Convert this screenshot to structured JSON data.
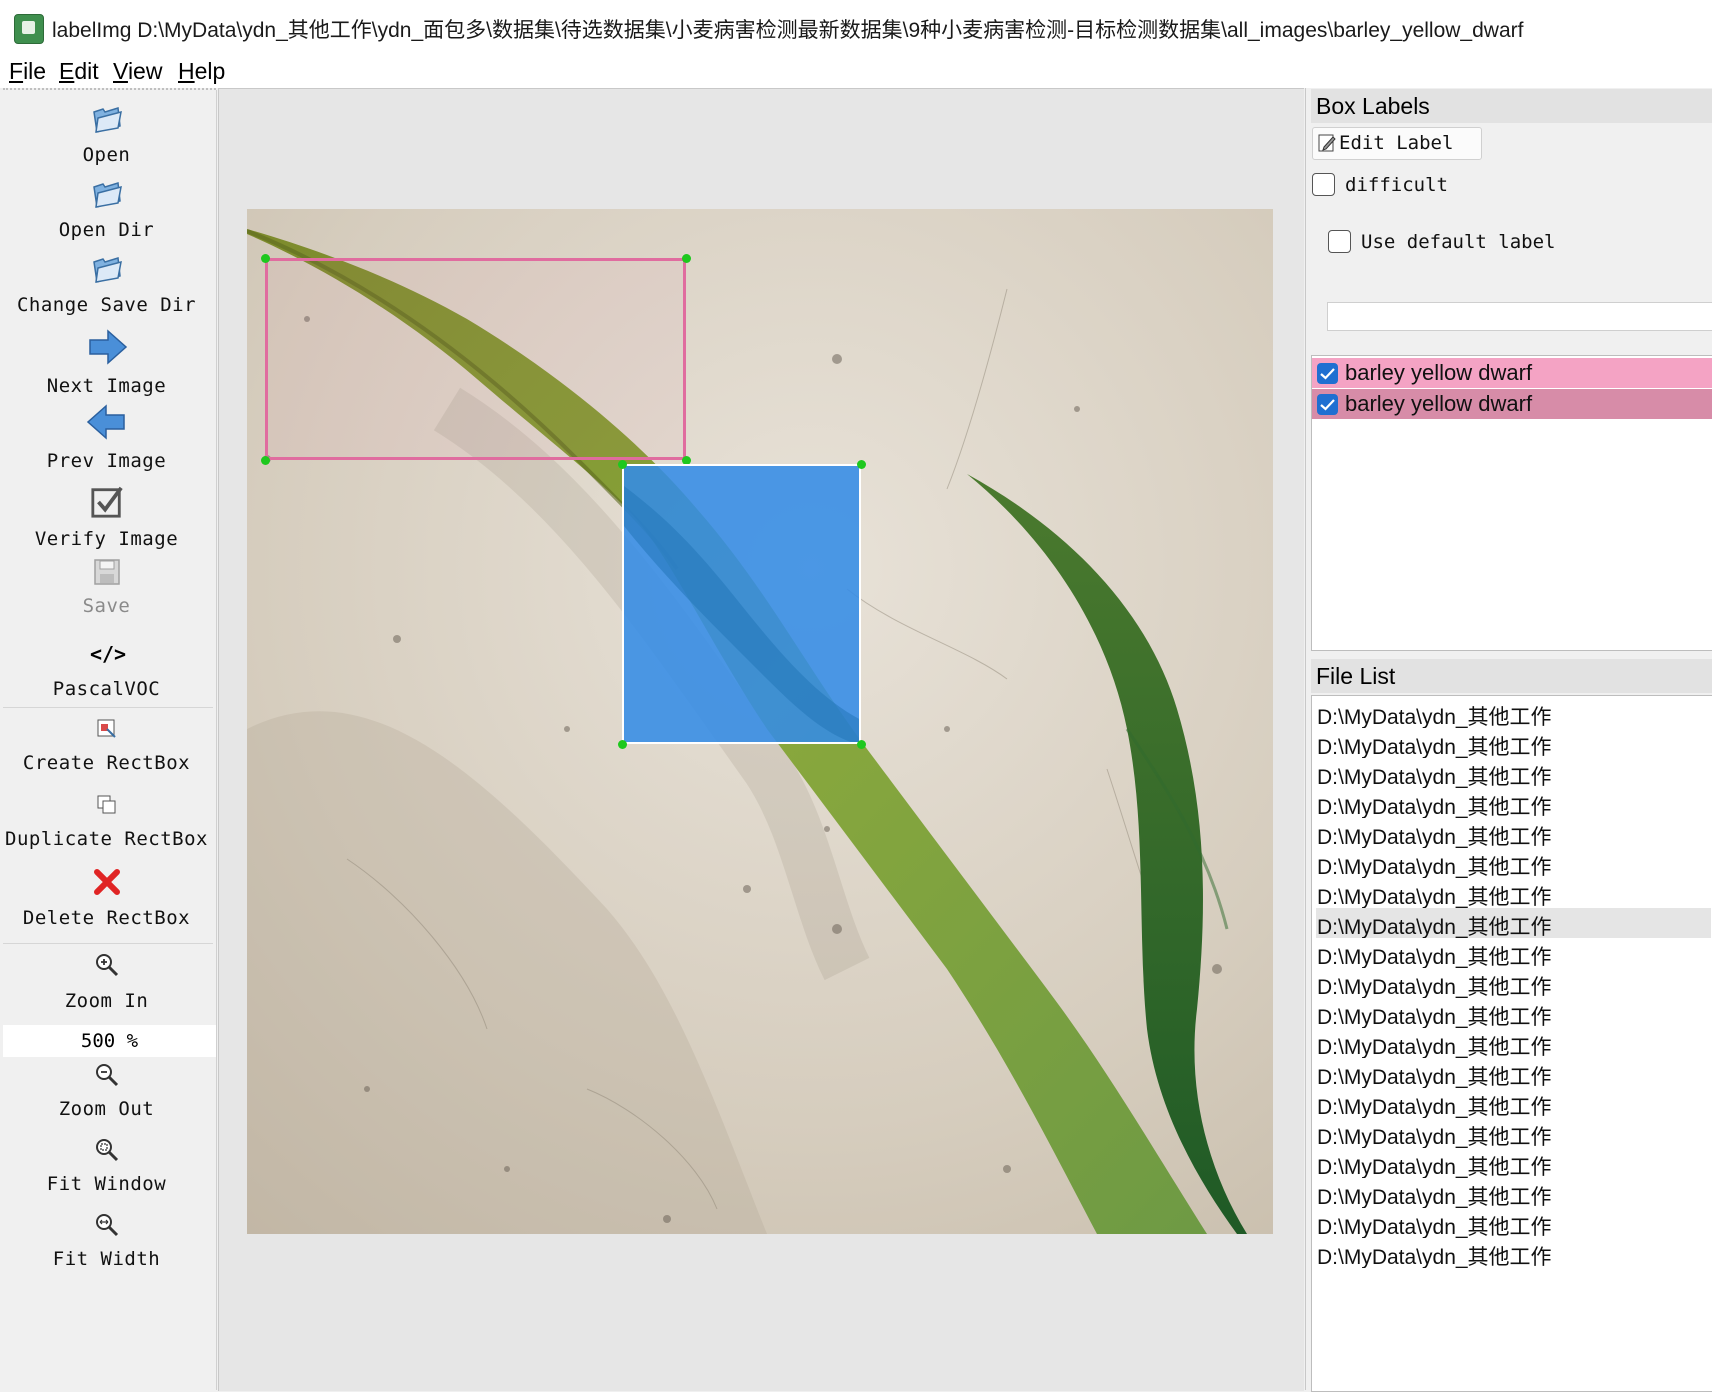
{
  "window": {
    "title": "labelImg D:\\MyData\\ydn_其他工作\\ydn_面包多\\数据集\\待选数据集\\小麦病害检测最新数据集\\9种小麦病害检测-目标检测数据集\\all_images\\barley_yellow_dwarf"
  },
  "menu": [
    "File",
    "Edit",
    "View",
    "Help"
  ],
  "toolbar": {
    "open": "Open",
    "open_dir": "Open Dir",
    "change_save_dir": "Change Save Dir",
    "next_image": "Next Image",
    "prev_image": "Prev Image",
    "verify_image": "Verify Image",
    "save": "Save",
    "format_icon": "</>",
    "format": "PascalVOC",
    "create_rectbox": "Create RectBox",
    "duplicate_rectbox": "Duplicate RectBox",
    "delete_rectbox": "Delete RectBox",
    "zoom_in": "Zoom In",
    "zoom_value": "500 %",
    "zoom_out": "Zoom Out",
    "fit_window": "Fit Window",
    "fit_width": "Fit Width"
  },
  "box_labels": {
    "title": "Box Labels",
    "edit_label": "Edit Label",
    "difficult": "difficult",
    "use_default_label": "Use default label",
    "default_label_value": "",
    "items": [
      {
        "label": "barley yellow dwarf",
        "checked": true,
        "color": "#f4a3c4"
      },
      {
        "label": "barley yellow dwarf",
        "checked": true,
        "color": "#d78ca8"
      }
    ]
  },
  "file_list": {
    "title": "File List",
    "items": [
      "D:\\MyData\\ydn_其他工作",
      "D:\\MyData\\ydn_其他工作",
      "D:\\MyData\\ydn_其他工作",
      "D:\\MyData\\ydn_其他工作",
      "D:\\MyData\\ydn_其他工作",
      "D:\\MyData\\ydn_其他工作",
      "D:\\MyData\\ydn_其他工作",
      "D:\\MyData\\ydn_其他工作",
      "D:\\MyData\\ydn_其他工作",
      "D:\\MyData\\ydn_其他工作",
      "D:\\MyData\\ydn_其他工作",
      "D:\\MyData\\ydn_其他工作",
      "D:\\MyData\\ydn_其他工作",
      "D:\\MyData\\ydn_其他工作",
      "D:\\MyData\\ydn_其他工作",
      "D:\\MyData\\ydn_其他工作",
      "D:\\MyData\\ydn_其他工作",
      "D:\\MyData\\ydn_其他工作",
      "D:\\MyData\\ydn_其他工作"
    ],
    "selected_index": 7
  },
  "colors": {
    "box_outline": "#e06c9f",
    "box_selected_fill": "#3f8fe6",
    "vertex": "#1ec81e"
  }
}
